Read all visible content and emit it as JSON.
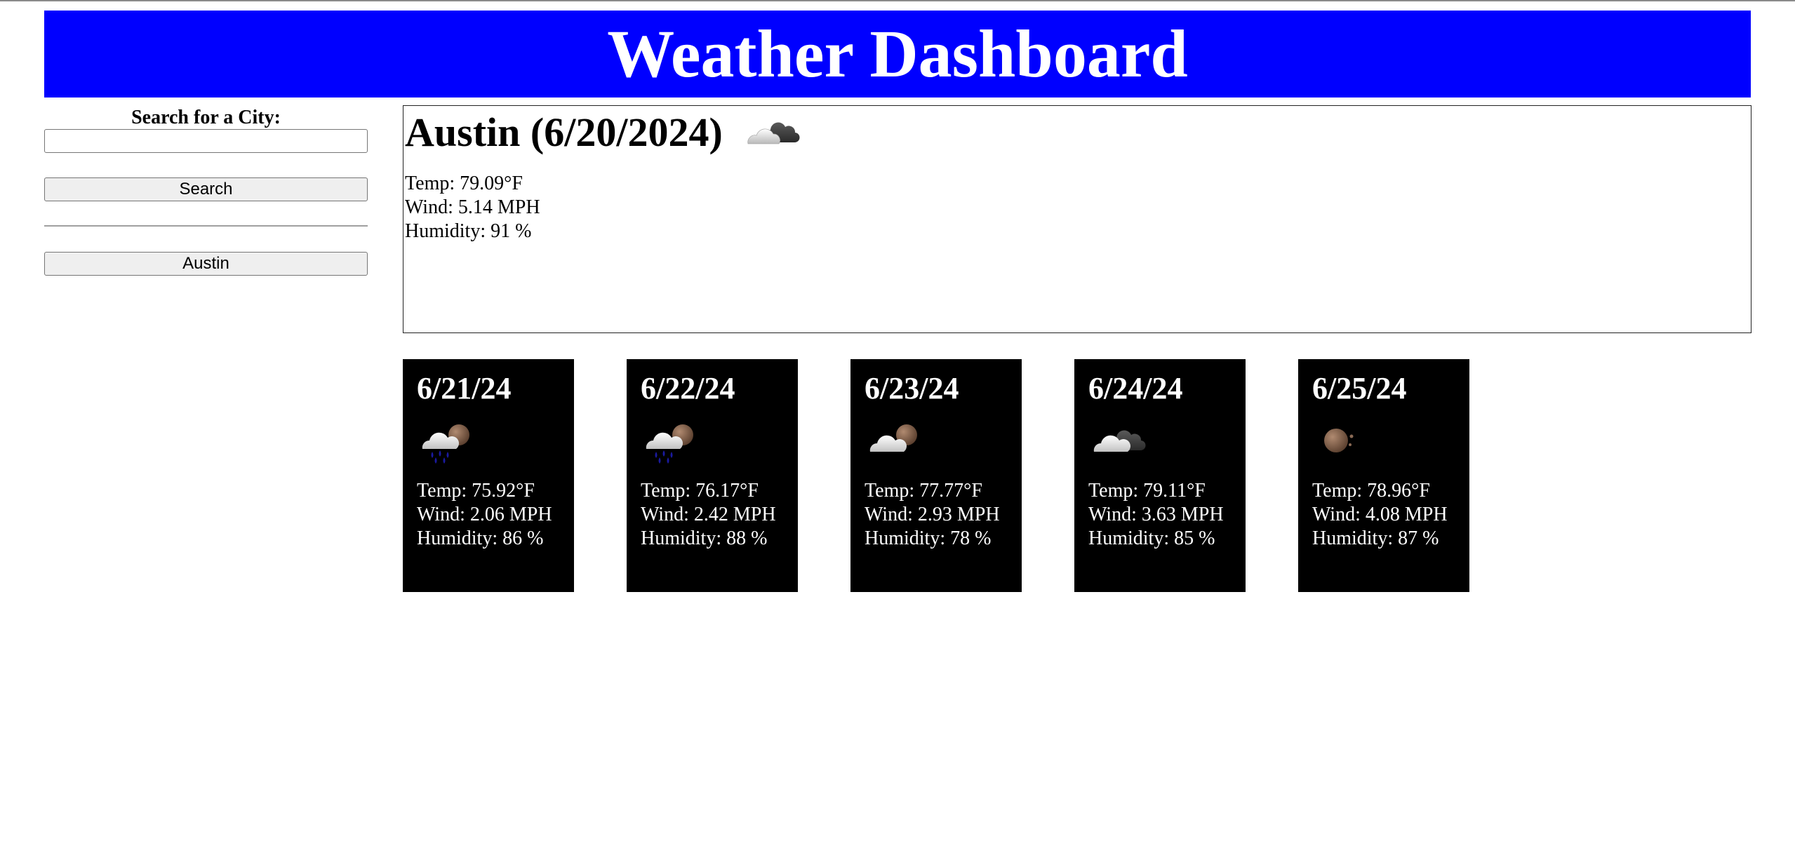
{
  "header": {
    "title": "Weather Dashboard",
    "background_color": "#0000ff"
  },
  "sidebar": {
    "search_label": "Search for a City:",
    "search_input_value": "",
    "search_button_label": "Search",
    "history": [
      "Austin"
    ]
  },
  "current": {
    "title": "Austin (6/20/2024)",
    "icon": "few-clouds-night-icon",
    "temp": "Temp: 79.09°F",
    "wind": "Wind: 5.14 MPH",
    "humidity": "Humidity: 91 %"
  },
  "forecast": [
    {
      "date": "6/21/24",
      "icon": "rain-night-icon",
      "temp": "Temp: 75.92°F",
      "wind": "Wind: 2.06 MPH",
      "humidity": "Humidity: 86 %"
    },
    {
      "date": "6/22/24",
      "icon": "rain-night-icon",
      "temp": "Temp: 76.17°F",
      "wind": "Wind: 2.42 MPH",
      "humidity": "Humidity: 88 %"
    },
    {
      "date": "6/23/24",
      "icon": "cloud-moon-icon",
      "temp": "Temp: 77.77°F",
      "wind": "Wind: 2.93 MPH",
      "humidity": "Humidity: 78 %"
    },
    {
      "date": "6/24/24",
      "icon": "broken-clouds-icon",
      "temp": "Temp: 79.11°F",
      "wind": "Wind: 3.63 MPH",
      "humidity": "Humidity: 85 %"
    },
    {
      "date": "6/25/24",
      "icon": "clear-night-icon",
      "temp": "Temp: 78.96°F",
      "wind": "Wind: 4.08 MPH",
      "humidity": "Humidity: 87 %"
    }
  ]
}
